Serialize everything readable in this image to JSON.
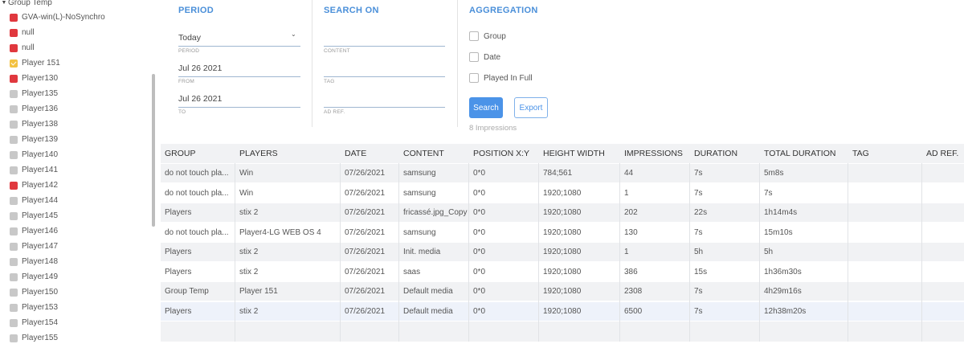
{
  "sidebar": {
    "group_label": "Group Temp",
    "items": [
      {
        "label": "GVA-win(L)-NoSynchro",
        "status": "red"
      },
      {
        "label": "null",
        "status": "red"
      },
      {
        "label": "null",
        "status": "red"
      },
      {
        "label": "Player 151",
        "status": "yellow"
      },
      {
        "label": "Player130",
        "status": "red"
      },
      {
        "label": "Player135",
        "status": "gray"
      },
      {
        "label": "Player136",
        "status": "gray"
      },
      {
        "label": "Player138",
        "status": "gray"
      },
      {
        "label": "Player139",
        "status": "gray"
      },
      {
        "label": "Player140",
        "status": "gray"
      },
      {
        "label": "Player141",
        "status": "gray"
      },
      {
        "label": "Player142",
        "status": "red"
      },
      {
        "label": "Player144",
        "status": "gray"
      },
      {
        "label": "Player145",
        "status": "gray"
      },
      {
        "label": "Player146",
        "status": "gray"
      },
      {
        "label": "Player147",
        "status": "gray"
      },
      {
        "label": "Player148",
        "status": "gray"
      },
      {
        "label": "Player149",
        "status": "gray"
      },
      {
        "label": "Player150",
        "status": "gray"
      },
      {
        "label": "Player153",
        "status": "gray"
      },
      {
        "label": "Player154",
        "status": "gray"
      },
      {
        "label": "Player155",
        "status": "gray"
      }
    ]
  },
  "period": {
    "title": "PERIOD",
    "period_value": "Today",
    "period_label": "PERIOD",
    "from_value": "Jul 26 2021",
    "from_label": "FROM",
    "to_value": "Jul 26 2021",
    "to_label": "TO"
  },
  "search_on": {
    "title": "SEARCH ON",
    "content_value": "",
    "content_label": "CONTENT",
    "tag_value": "",
    "tag_label": "TAG",
    "adref_value": "",
    "adref_label": "AD REF."
  },
  "aggregation": {
    "title": "AGGREGATION",
    "options": [
      {
        "label": "Group",
        "checked": false
      },
      {
        "label": "Date",
        "checked": false
      },
      {
        "label": "Played In Full",
        "checked": false
      }
    ],
    "search_label": "Search",
    "export_label": "Export",
    "impressions_text": "8 Impressions"
  },
  "table": {
    "headers": [
      "GROUP",
      "PLAYERS",
      "DATE",
      "CONTENT",
      "POSITION X:Y",
      "HEIGHT WIDTH",
      "IMPRESSIONS",
      "DURATION",
      "TOTAL DURATION",
      "TAG",
      "AD REF."
    ],
    "rows": [
      [
        "do not touch pla...",
        "Win",
        "07/26/2021",
        "samsung",
        "0*0",
        "784;561",
        "44",
        "7s",
        "5m8s",
        "",
        ""
      ],
      [
        "do not touch pla...",
        "Win",
        "07/26/2021",
        "samsung",
        "0*0",
        "1920;1080",
        "1",
        "7s",
        "7s",
        "",
        ""
      ],
      [
        "Players",
        "stix 2",
        "07/26/2021",
        "fricassé.jpg_Copy",
        "0*0",
        "1920;1080",
        "202",
        "22s",
        "1h14m4s",
        "",
        ""
      ],
      [
        "do not touch pla...",
        "Player4-LG WEB OS 4",
        "07/26/2021",
        "samsung",
        "0*0",
        "1920;1080",
        "130",
        "7s",
        "15m10s",
        "",
        ""
      ],
      [
        "Players",
        "stix 2",
        "07/26/2021",
        "Init. media",
        "0*0",
        "1920;1080",
        "1",
        "5h",
        "5h",
        "",
        ""
      ],
      [
        "Players",
        "stix 2",
        "07/26/2021",
        "saas",
        "0*0",
        "1920;1080",
        "386",
        "15s",
        "1h36m30s",
        "",
        ""
      ],
      [
        "Group Temp",
        "Player 151",
        "07/26/2021",
        "Default media",
        "0*0",
        "1920;1080",
        "2308",
        "7s",
        "4h29m16s",
        "",
        ""
      ],
      [
        "Players",
        "stix 2",
        "07/26/2021",
        "Default media",
        "0*0",
        "1920;1080",
        "6500",
        "7s",
        "12h38m20s",
        "",
        ""
      ]
    ]
  },
  "colors": {
    "accent": "#4a8fd9",
    "status_red": "#e0383e",
    "status_gray": "#c8c8c8",
    "status_yellow": "#f3c242"
  }
}
